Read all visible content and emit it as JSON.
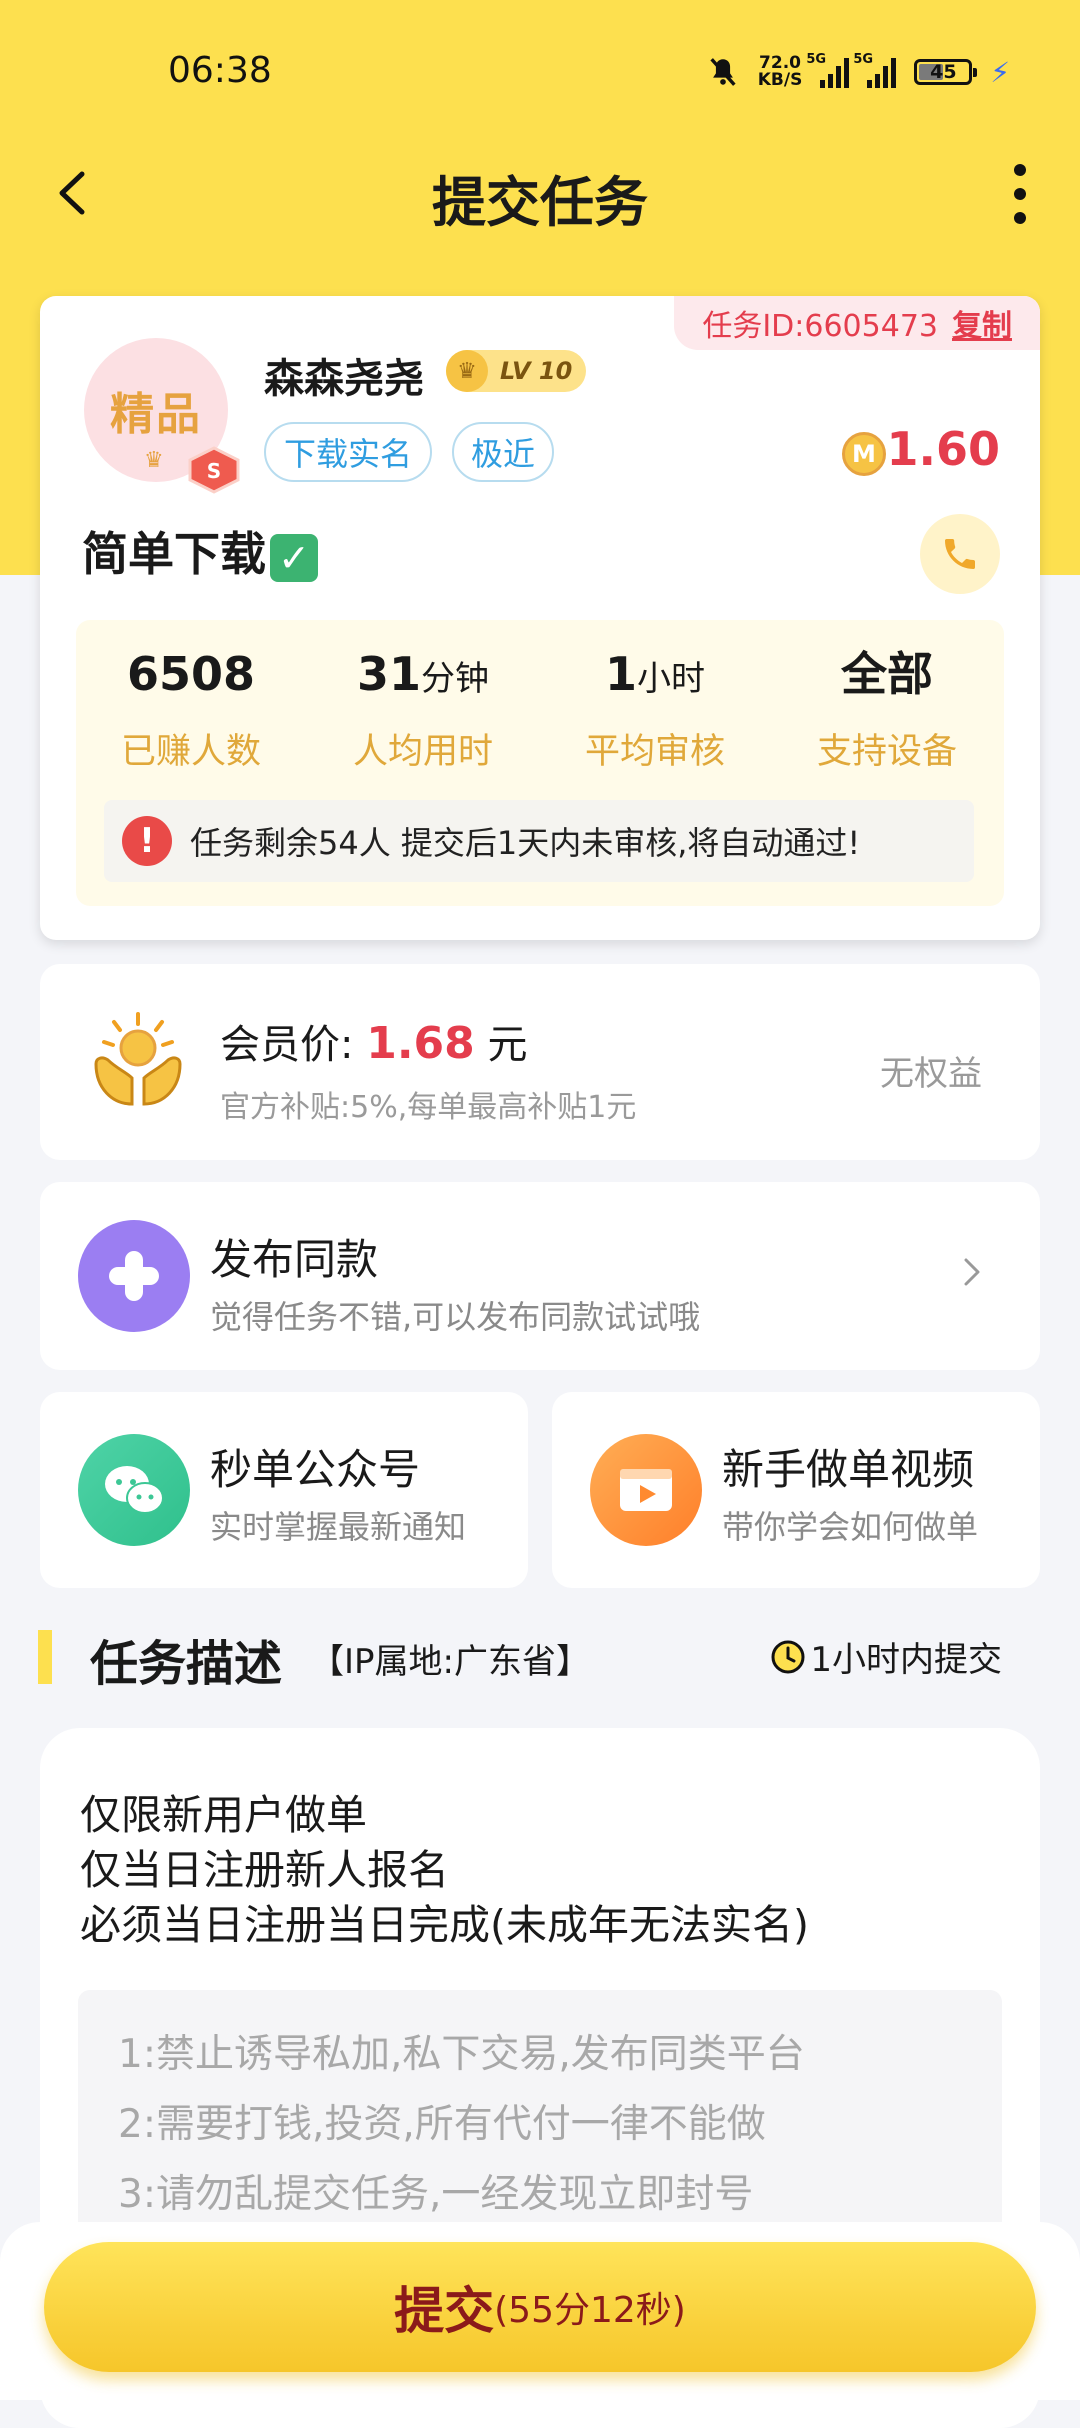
{
  "status_bar": {
    "time": "06:38",
    "net_speed": "72.0",
    "net_unit": "KB/S",
    "network_1": "5G",
    "network_2": "5G",
    "battery": "45"
  },
  "header": {
    "title": "提交任务"
  },
  "task": {
    "id_label": "任务ID:6605473",
    "copy_label": "复制",
    "avatar_text": "精品",
    "user_name": "森森尧尧",
    "level": "LV 10",
    "tags": [
      "下载实名",
      "极近"
    ],
    "reward": "1.60",
    "title": "简单下载",
    "stats": [
      {
        "value": "6508",
        "unit": "",
        "label": "已赚人数"
      },
      {
        "value": "31",
        "unit": "分钟",
        "label": "人均用时"
      },
      {
        "value": "1",
        "unit": "小时",
        "label": "平均审核"
      },
      {
        "value": "全部",
        "unit": "",
        "label": "支持设备"
      }
    ],
    "notice": "任务剩余54人  提交后1天内未审核,将自动通过!"
  },
  "member": {
    "label": "会员价:",
    "price": "1.68",
    "unit": "元",
    "subsidy": "官方补贴:5%,每单最高补贴1元",
    "benefit": "无权益"
  },
  "publish": {
    "title": "发布同款",
    "subtitle": "觉得任务不错,可以发布同款试试哦"
  },
  "mini_cards": [
    {
      "title": "秒单公众号",
      "subtitle": "实时掌握最新通知"
    },
    {
      "title": "新手做单视频",
      "subtitle": "带你学会如何做单"
    }
  ],
  "description": {
    "section_title": "任务描述",
    "ip_location": "【IP属地:广东省】",
    "time_limit": "1小时内提交",
    "lines": [
      "仅限新用户做单",
      "仅当日注册新人报名",
      "必须当日注册当日完成(未成年无法实名)"
    ],
    "rules": [
      "1:禁止诱导私加,私下交易,发布同类平台",
      "2:需要打钱,投资,所有代付一律不能做",
      "3:请勿乱提交任务,一经发现立即封号"
    ]
  },
  "submit": {
    "label": "提交",
    "countdown": "(55分12秒)"
  },
  "colors": {
    "brand_yellow": "#fde04f",
    "price_red": "#e43d4d",
    "tag_blue": "#2f9de0",
    "stat_gold": "#e0a83a"
  },
  "icons": [
    "back-icon",
    "more-icon",
    "level-icon",
    "coin-icon",
    "check-icon",
    "phone-icon",
    "warning-icon",
    "member-hands-icon",
    "plus-icon",
    "chevron-right-icon",
    "wechat-icon",
    "video-icon",
    "clock-icon"
  ]
}
